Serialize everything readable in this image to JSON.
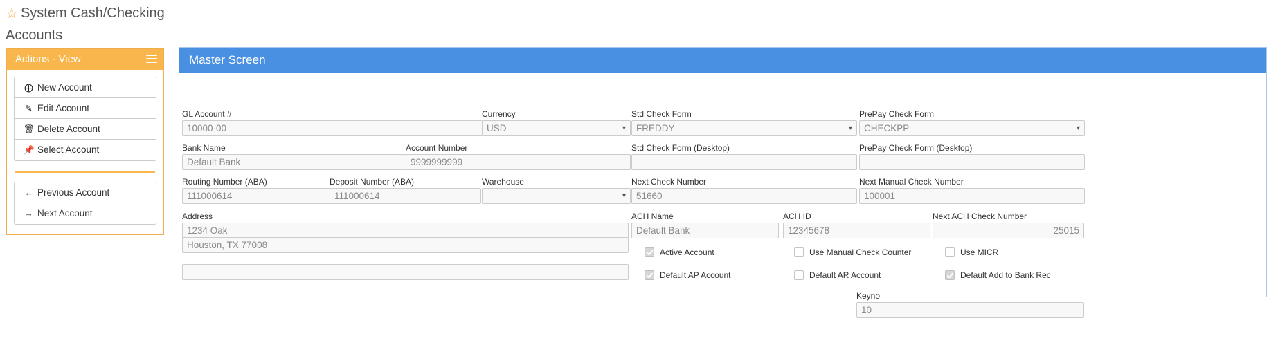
{
  "page": {
    "title": "System Cash/Checking Accounts",
    "star_icon": "star-icon"
  },
  "actions_panel": {
    "header": "Actions - View",
    "menu_icon": "hamburger-menu-icon",
    "primary_items": [
      {
        "label": "New Account",
        "icon": "plus-square-icon",
        "glyph": "✚"
      },
      {
        "label": "Edit Account",
        "icon": "pencil-icon",
        "glyph": "✎"
      },
      {
        "label": "Delete Account",
        "icon": "trash-icon",
        "glyph": "🗑"
      },
      {
        "label": "Select Account",
        "icon": "pin-icon",
        "glyph": "📌"
      }
    ],
    "nav_items": [
      {
        "label": "Previous Account",
        "icon": "arrow-left-icon",
        "glyph": "←"
      },
      {
        "label": "Next Account",
        "icon": "arrow-right-icon",
        "glyph": "→"
      }
    ]
  },
  "master": {
    "header": "Master Screen",
    "fields": {
      "gl_account": {
        "label": "GL Account #",
        "value": "10000-00"
      },
      "currency": {
        "label": "Currency",
        "value": "USD"
      },
      "std_check_form": {
        "label": "Std Check Form",
        "value": "FREDDY"
      },
      "prepay_check_form": {
        "label": "PrePay Check Form",
        "value": "CHECKPP"
      },
      "bank_name": {
        "label": "Bank Name",
        "value": "Default Bank"
      },
      "account_number": {
        "label": "Account Number",
        "value": "9999999999"
      },
      "std_check_form_desktop": {
        "label": "Std Check Form (Desktop)",
        "value": ""
      },
      "prepay_check_form_desktop": {
        "label": "PrePay Check Form (Desktop)",
        "value": ""
      },
      "routing_number": {
        "label": "Routing Number (ABA)",
        "value": "111000614"
      },
      "deposit_number": {
        "label": "Deposit Number (ABA)",
        "value": "111000614"
      },
      "warehouse": {
        "label": "Warehouse",
        "value": ""
      },
      "next_check_number": {
        "label": "Next Check Number",
        "value": "51660"
      },
      "next_manual_check_number": {
        "label": "Next Manual Check Number",
        "value": "100001"
      },
      "address": {
        "label": "Address",
        "value": "1234 Oak"
      },
      "address_line2": {
        "value": "Houston, TX 77008"
      },
      "address_line3": {
        "value": ""
      },
      "ach_name": {
        "label": "ACH Name",
        "value": "Default Bank"
      },
      "ach_id": {
        "label": "ACH ID",
        "value": "12345678"
      },
      "next_ach_check_number": {
        "label": "Next ACH Check Number",
        "value": "25015"
      },
      "keyno": {
        "label": "Keyno",
        "value": "10"
      }
    },
    "checkboxes": [
      {
        "label": "Active Account",
        "checked": true
      },
      {
        "label": "Use Manual Check Counter",
        "checked": false
      },
      {
        "label": "Use MICR",
        "checked": false
      },
      {
        "label": "Default AP Account",
        "checked": true
      },
      {
        "label": "Default AR Account",
        "checked": false
      },
      {
        "label": "Default Add to Bank Rec",
        "checked": true
      }
    ]
  },
  "colors": {
    "accent_orange": "#f8b64c",
    "accent_blue": "#4a90e2",
    "star_gold": "#f5a93b"
  }
}
